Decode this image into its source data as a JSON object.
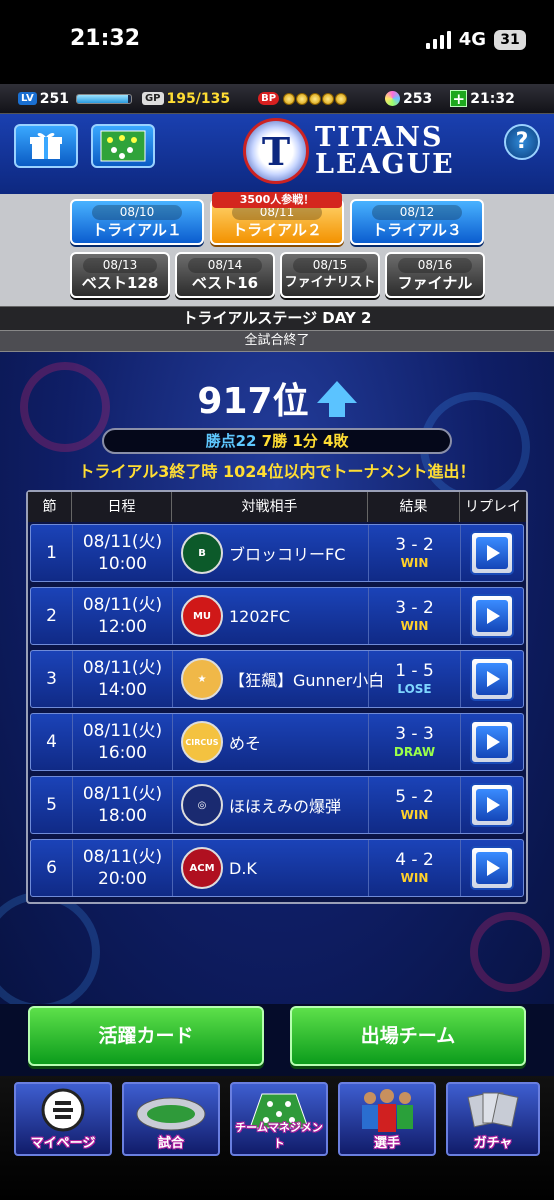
{
  "status_bar": {
    "time": "21:32",
    "network": "4G",
    "battery": "31"
  },
  "top_bar": {
    "lv_tag": "LV",
    "level": "251",
    "level_progress": 0.95,
    "gp_tag": "GP",
    "gp": "195/135",
    "bp_tag": "BP",
    "bp_coins": 5,
    "gems": "253",
    "stamina_time": "21:32"
  },
  "header": {
    "logo_mark": "T",
    "logo_line1": "TITANS",
    "logo_line2": "LEAGUE",
    "help_label": "?"
  },
  "days": {
    "participants_note": "3500人参戦！",
    "row1": [
      {
        "date": "08/10",
        "label": "トライアル１",
        "state": "blue"
      },
      {
        "date": "08/11",
        "label": "トライアル２",
        "state": "orange"
      },
      {
        "date": "08/12",
        "label": "トライアル３",
        "state": "blue"
      }
    ],
    "row2": [
      {
        "date": "08/13",
        "label": "ベスト128",
        "state": "gray"
      },
      {
        "date": "08/14",
        "label": "ベスト16",
        "state": "gray"
      },
      {
        "date": "08/15",
        "label": "ファイナリスト",
        "state": "gray"
      },
      {
        "date": "08/16",
        "label": "ファイナル",
        "state": "gray"
      }
    ]
  },
  "stage_title": "トライアルステージ DAY 2",
  "stage_state": "全試合終了",
  "rank": {
    "value": "917位",
    "trend": "up"
  },
  "points": {
    "label": "勝点22",
    "record": "7勝 1分 4敗"
  },
  "advance_note": "トライアル3終了時 1024位以内でトーナメント進出！",
  "table": {
    "headers": [
      "節",
      "日程",
      "対戦相手",
      "結果",
      "リプレイ"
    ],
    "rows": [
      {
        "no": "1",
        "date": "08/11(火)",
        "time": "10:00",
        "opponent": "ブロッコリーFC",
        "score": "3 - 2",
        "result": "WIN",
        "result_color": "#ffd12a",
        "emblem_bg": "#0c5a2a",
        "emblem_text": "B"
      },
      {
        "no": "2",
        "date": "08/11(火)",
        "time": "12:00",
        "opponent": "1202FC",
        "score": "3 - 2",
        "result": "WIN",
        "result_color": "#ffd12a",
        "emblem_bg": "#d01818",
        "emblem_text": "MU"
      },
      {
        "no": "3",
        "date": "08/11(火)",
        "time": "14:00",
        "opponent": "【狂飆】Gunner小白",
        "score": "1 - 5",
        "result": "LOSE",
        "result_color": "#7fd6ff",
        "emblem_bg": "#f0b848",
        "emblem_text": "★"
      },
      {
        "no": "4",
        "date": "08/11(火)",
        "time": "16:00",
        "opponent": "めそ",
        "score": "3 - 3",
        "result": "DRAW",
        "result_color": "#9aff4a",
        "emblem_bg": "#f4c240",
        "emblem_text": "CIRCUS"
      },
      {
        "no": "5",
        "date": "08/11(火)",
        "time": "18:00",
        "opponent": "ほほえみの爆弾",
        "score": "5 - 2",
        "result": "WIN",
        "result_color": "#ffd12a",
        "emblem_bg": "#1a2a70",
        "emblem_text": "◎"
      },
      {
        "no": "6",
        "date": "08/11(火)",
        "time": "20:00",
        "opponent": "D.K",
        "score": "4 - 2",
        "result": "WIN",
        "result_color": "#ffd12a",
        "emblem_bg": "#b01020",
        "emblem_text": "ACM"
      }
    ]
  },
  "buttons": {
    "highlight_cards": "活躍カード",
    "lineup_team": "出場チーム"
  },
  "nav": [
    {
      "label": "マイページ",
      "icon": "efootball-icon"
    },
    {
      "label": "試合",
      "icon": "stadium-icon"
    },
    {
      "label": "チームマネジメント",
      "icon": "pitch-formation-icon"
    },
    {
      "label": "選手",
      "icon": "players-icon"
    },
    {
      "label": "ガチャ",
      "icon": "cards-icon"
    }
  ]
}
